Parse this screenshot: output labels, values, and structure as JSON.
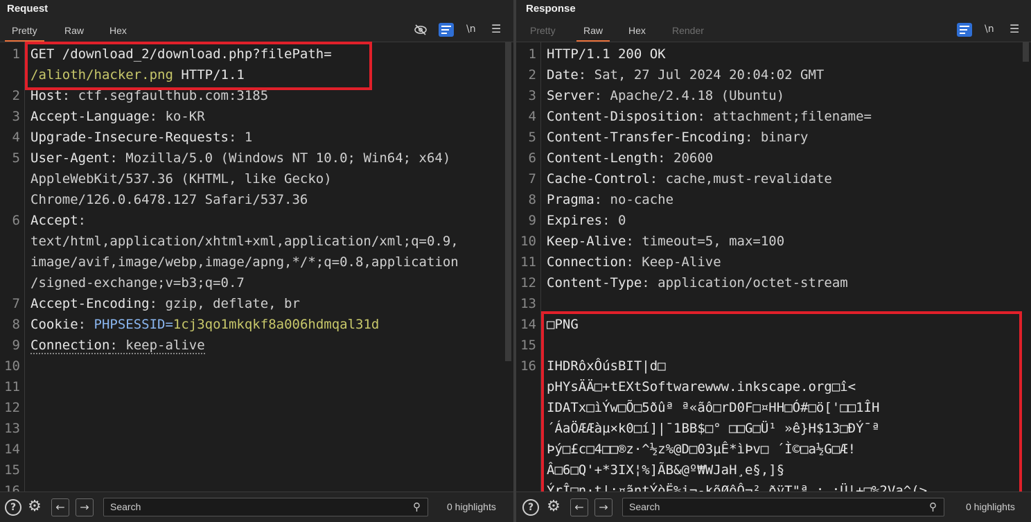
{
  "request": {
    "title": "Request",
    "tabs": [
      "Pretty",
      "Raw",
      "Hex"
    ],
    "active_tab": "Pretty",
    "icons": {
      "hide": "eye-off-icon",
      "wrap": "word-wrap-icon",
      "newline": "\\n",
      "menu": "menu-icon"
    },
    "line_numbers": [
      "1",
      "2",
      "3",
      "4",
      "5",
      "6",
      "7",
      "8",
      "9",
      "10",
      "11",
      "12",
      "13",
      "14",
      "15",
      "16"
    ],
    "l1a": "GET /download_2/download.php?filePath=",
    "l1b": "/alioth/hacker.png",
    "l1c": " HTTP/1.1",
    "h_host_k": "Host",
    "h_host_v": ": ctf.segfaulthub.com:3185",
    "h_lang_k": "Accept-Language",
    "h_lang_v": ": ko-KR",
    "h_uir_k": "Upgrade-Insecure-Requests",
    "h_uir_v": ": 1",
    "h_ua_k": "User-Agent",
    "h_ua_v1": ": Mozilla/5.0 (Windows NT 10.0; Win64; x64)",
    "h_ua_v2": "AppleWebKit/537.36 (KHTML, like Gecko)",
    "h_ua_v3": "Chrome/126.0.6478.127 Safari/537.36",
    "h_acc_k": "Accept",
    "h_acc_v0": ":",
    "h_acc_v1": "text/html,application/xhtml+xml,application/xml;q=0.9,",
    "h_acc_v2": "image/avif,image/webp,image/apng,*/*;q=0.8,application",
    "h_acc_v3": "/signed-exchange;v=b3;q=0.7",
    "h_enc_k": "Accept-Encoding",
    "h_enc_v": ": gzip, deflate, br",
    "h_cookie_k": "Cookie",
    "h_cookie_sep": ": ",
    "h_cookie_name": "PHPSESSID=",
    "h_cookie_val": "1cj3qo1mkqkf8a006hdmqal31d",
    "h_conn_k": "Connection",
    "h_conn_v": ": keep-alive",
    "search_placeholder": "Search",
    "highlights": "0 highlights"
  },
  "response": {
    "title": "Response",
    "tabs": [
      "Pretty",
      "Raw",
      "Hex",
      "Render"
    ],
    "active_tab": "Raw",
    "line_numbers": [
      "1",
      "2",
      "3",
      "4",
      "5",
      "6",
      "7",
      "8",
      "9",
      "10",
      "11",
      "12",
      "13",
      "14",
      "15",
      "16"
    ],
    "l1": "HTTP/1.1 200 OK",
    "h_date_k": "Date",
    "h_date_v": ": Sat, 27 Jul 2024 20:04:02 GMT",
    "h_server_k": "Server",
    "h_server_v": ": Apache/2.4.18 (Ubuntu)",
    "h_cd_k": "Content-Disposition",
    "h_cd_v": ": attachment;filename=",
    "h_cte_k": "Content-Transfer-Encoding",
    "h_cte_v": ": binary",
    "h_cl_k": "Content-Length",
    "h_cl_v": ": 20600",
    "h_cc_k": "Cache-Control",
    "h_cc_v": ": cache,must-revalidate",
    "h_pragma_k": "Pragma",
    "h_pragma_v": ": no-cache",
    "h_exp_k": "Expires",
    "h_exp_v": ": 0",
    "h_ka_k": "Keep-Alive",
    "h_ka_v": ": timeout=5, max=100",
    "h_conn_k": "Connection",
    "h_conn_v": ": Keep-Alive",
    "h_ct_k": "Content-Type",
    "h_ct_v": ": application/octet-stream",
    "b14": "□PNG",
    "b16_1": "IHDRôxÔúsBIT|d□",
    "b16_2": "pHYsÄÄ□+tEXtSoftwarewww.inkscape.org□î<",
    "b16_3": "IDATx□ìÝw□Õ□5ðûª ª«ãô□rD0F□¤HH□Ó#□ö['□□1ÎH",
    "b16_4": "´ÁaÖÆÆàµ×k0□í]|¯1BB$□° □□G□Ü¹ »ê}H$13□ÐÝ¯ª",
    "b16_5": "Þý□£c□4□□®z·^½z%@D□03µÊ*ìÞv□ ´Ì©□a½G□Æ!",
    "b16_6": "Â□6□Q'+*3IX¦%]ÃB&@º₩WJaH¸e§,]§",
    "b16_7": "ÝrÎ□n·t|;¤ãntÝòË%i¬-kõØôÔ¬²_ðÿT\"ª ; ;Ü|+□%2Va^(>",
    "search_placeholder": "Search",
    "highlights": "0 highlights"
  }
}
